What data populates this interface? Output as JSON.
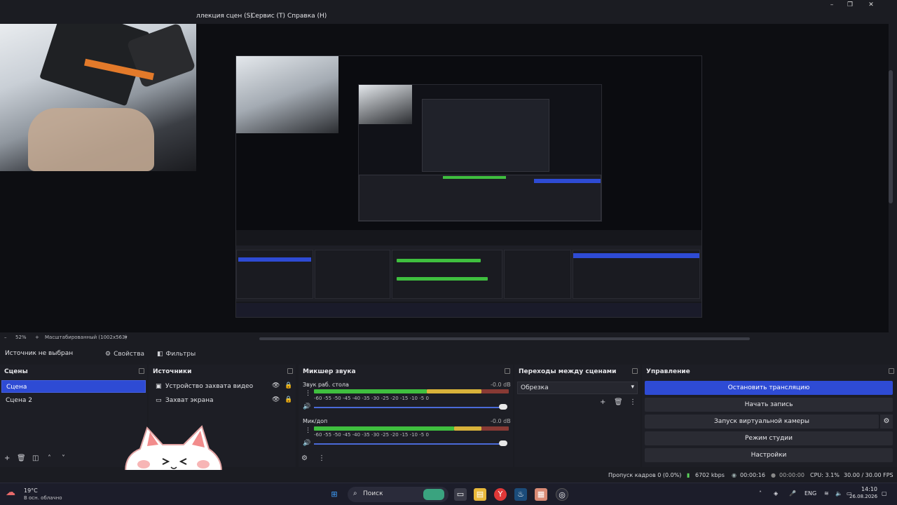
{
  "menu": {
    "items": [
      "ллекция сцен (S)",
      "Сервис (T)",
      "Справка (H)"
    ]
  },
  "window_controls": [
    "–",
    "❐",
    "✕"
  ],
  "zoom": {
    "percent": "52%",
    "mode": "Масштабированный (1002x563)"
  },
  "source_bar": {
    "no_source": "Источник не выбран",
    "properties": "Свойства",
    "filters": "Фильтры"
  },
  "scenes": {
    "title": "Сцены",
    "items": [
      "Сцена",
      "Сцена 2"
    ],
    "selected_index": 0
  },
  "sources": {
    "title": "Источники",
    "items": [
      "Устройство захвата видео",
      "Захват экрана"
    ]
  },
  "mixer": {
    "title": "Микшер звука",
    "channels": [
      {
        "name": "Звук раб. стола",
        "db": "-0.0 dB",
        "level": 0.58,
        "peak": 0.86
      },
      {
        "name": "Мик/доп",
        "db": "-0.0 dB",
        "level": 0.72,
        "peak": 0.86
      }
    ],
    "scale": [
      "-60",
      "-55",
      "-50",
      "-45",
      "-40",
      "-35",
      "-30",
      "-25",
      "-20",
      "-15",
      "-10",
      "-5",
      "0"
    ]
  },
  "transitions": {
    "title": "Переходы между сценами",
    "selected": "Обрезка"
  },
  "controls": {
    "title": "Управление",
    "buttons": [
      "Остановить трансляцию",
      "Начать запись",
      "Запуск виртуальной камеры",
      "Режим студии",
      "Настройки"
    ]
  },
  "status": {
    "dropped": "Пропуск кадров 0 (0.0%)",
    "bitrate": "6702 kbps",
    "stream_time": "00:00:16",
    "rec_time": "00:00:00",
    "cpu": "CPU: 3.1%",
    "fps": "30.00 / 30.00 FPS"
  },
  "taskbar": {
    "weather_temp": "19°C",
    "weather_desc": "В осн. облачно",
    "search": "Поиск",
    "lang": "ENG",
    "time": "14:10",
    "date": "26.08.2026"
  },
  "colors": {
    "accent": "#2e4bd4",
    "meter_green": "#3fbf3f",
    "meter_yellow": "#d8b23a",
    "meter_red": "#c63a3a",
    "bitrate_green": "#5ad15a"
  }
}
